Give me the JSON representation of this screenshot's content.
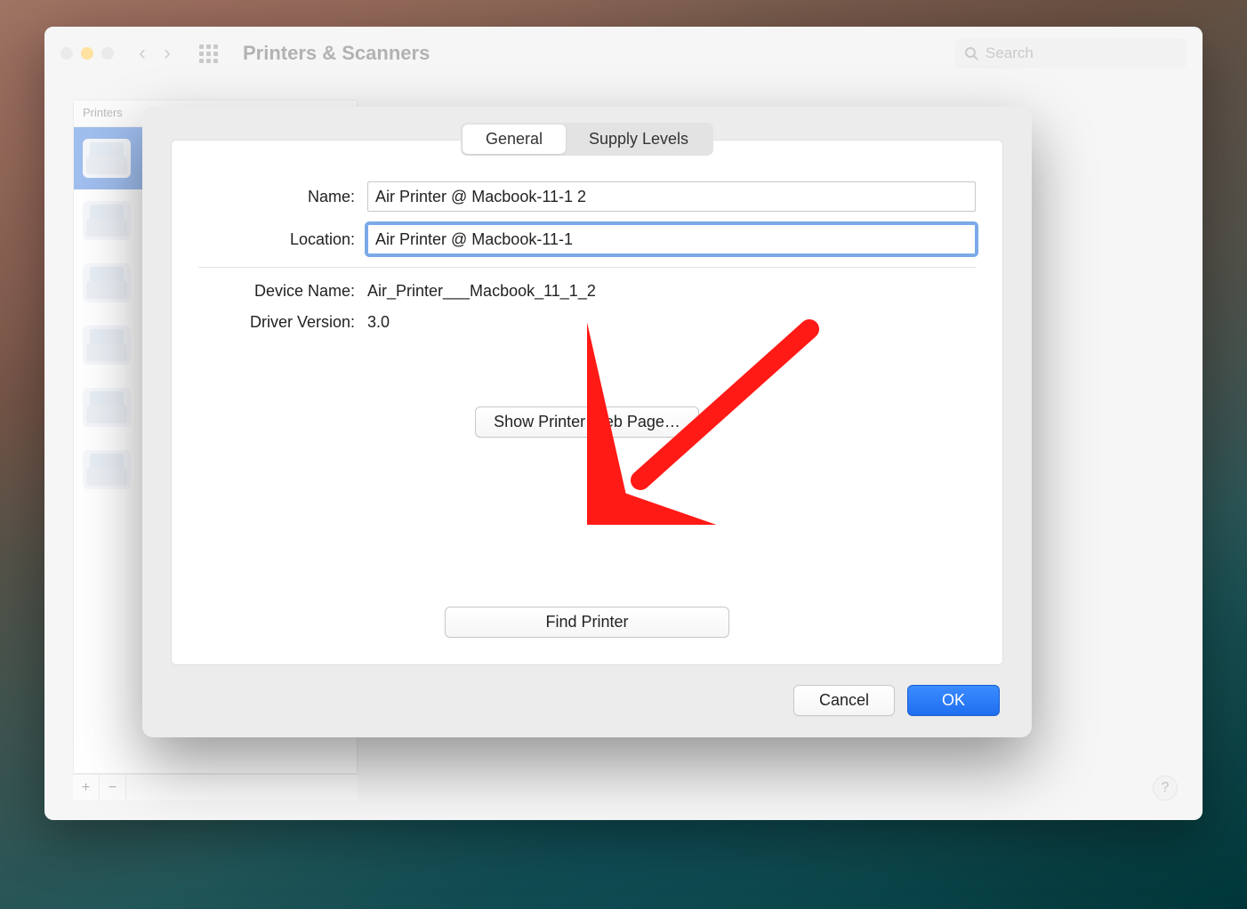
{
  "prefs": {
    "title": "Printers & Scanners",
    "search_placeholder": "Search",
    "list_header": "Printers",
    "add_label": "+",
    "remove_label": "−"
  },
  "modal": {
    "tabs": {
      "general": "General",
      "supply": "Supply Levels"
    },
    "labels": {
      "name": "Name:",
      "location": "Location:",
      "device_name": "Device Name:",
      "driver_version": "Driver Version:"
    },
    "values": {
      "name": "Air Printer @ Macbook-11-1 2",
      "location": "Air Printer @ Macbook-11-1",
      "device_name": "Air_Printer___Macbook_11_1_2",
      "driver_version": "3.0"
    },
    "buttons": {
      "show_web": "Show Printer Web Page…",
      "find_printer": "Find Printer",
      "cancel": "Cancel",
      "ok": "OK"
    }
  }
}
